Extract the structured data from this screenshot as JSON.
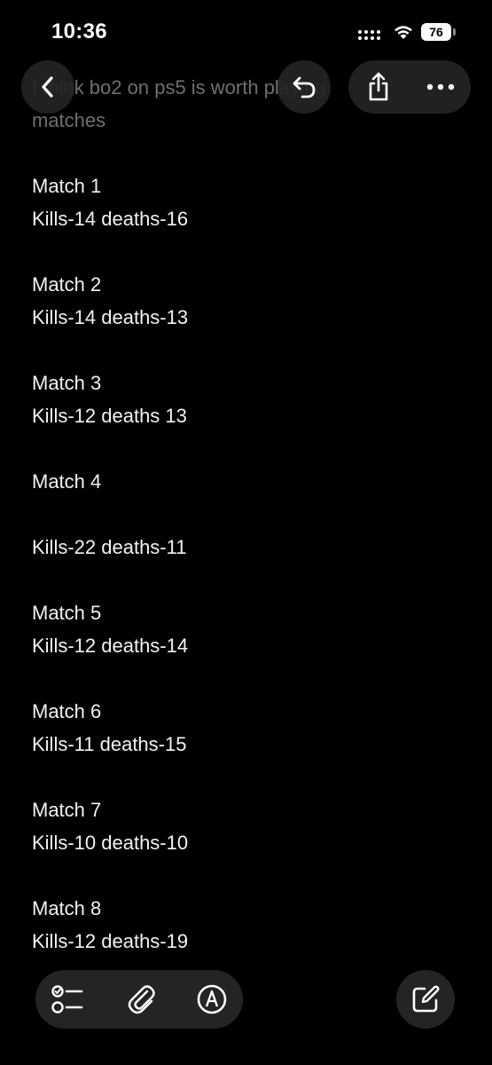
{
  "status_bar": {
    "time": "10:36",
    "battery": "76"
  },
  "note": {
    "title_line1": "I think bo2 on ps5 is worth playing",
    "title_line2": "matches",
    "matches": [
      {
        "label": "Match 1",
        "stats": "Kills-14 deaths-16"
      },
      {
        "label": "Match 2",
        "stats": "Kills-14 deaths-13"
      },
      {
        "label": "Match 3",
        "stats": "Kills-12 deaths 13"
      },
      {
        "label": "Match 4",
        "stats": "Kills-22 deaths-11"
      },
      {
        "label": "Match 5",
        "stats": "Kills-12 deaths-14"
      },
      {
        "label": "Match 6",
        "stats": "Kills-11 deaths-15"
      },
      {
        "label": "Match 7",
        "stats": "Kills-10 deaths-10"
      },
      {
        "label": "Match 8",
        "stats": "Kills-12 deaths-19"
      }
    ]
  },
  "icons": {
    "back": "chevron-left-icon",
    "undo": "undo-icon",
    "share": "share-icon",
    "more": "more-icon",
    "checklist": "checklist-icon",
    "attach": "paperclip-icon",
    "markup": "markup-pen-icon",
    "compose": "compose-icon"
  },
  "colors": {
    "background": "#000000",
    "text": "#f2f2f2",
    "title_faded": "#6f6f6f",
    "button_bg": "#242424"
  }
}
